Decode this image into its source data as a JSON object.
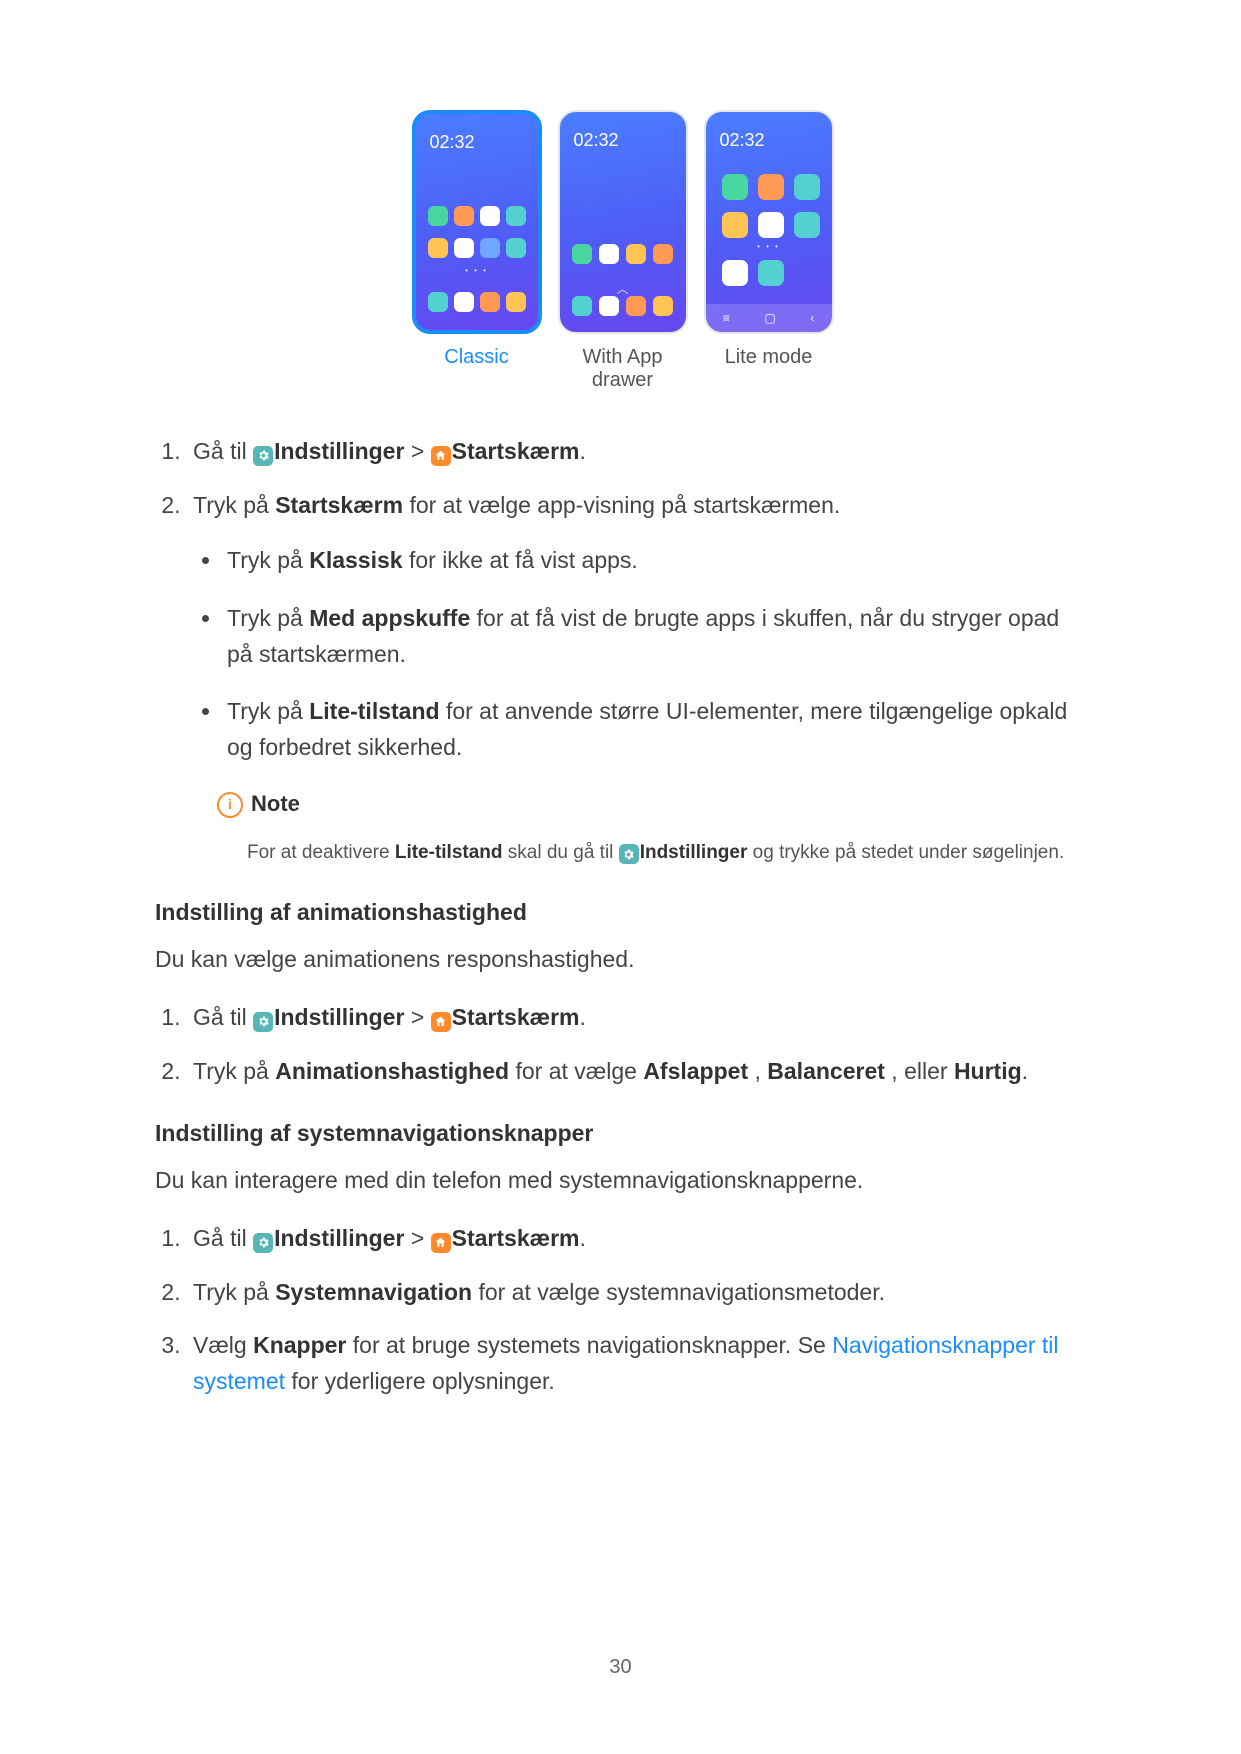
{
  "phones": {
    "clock": "02:32",
    "captions": {
      "classic": "Classic",
      "drawer": "With App drawer",
      "lite": "Lite mode"
    }
  },
  "section1": {
    "step1": {
      "prefix": "Gå til ",
      "settings": "Indstillinger",
      "sep": " > ",
      "home": "Startskærm",
      "end": "."
    },
    "step2": {
      "t1": "Tryk på ",
      "b1": "Startskærm",
      "t2": " for at vælge app-visning på startskærmen."
    },
    "bul1": {
      "t1": "Tryk på ",
      "b1": "Klassisk",
      "t2": " for ikke at få vist apps."
    },
    "bul2": {
      "t1": "Tryk på ",
      "b1": "Med appskuffe",
      "t2": " for at få vist de brugte apps i skuffen, når du stryger opad på startskærmen."
    },
    "bul3": {
      "t1": "Tryk på ",
      "b1": "Lite-tilstand",
      "t2": " for at anvende større UI-elementer, mere tilgængelige opkald og forbedret sikkerhed."
    }
  },
  "note": {
    "label": "Note",
    "t1": "For at deaktivere ",
    "b1": "Lite-tilstand",
    "t2": " skal du gå til ",
    "b2": "Indstillinger",
    "t3": " og trykke på stedet under søgelinjen."
  },
  "section2": {
    "heading": "Indstilling af animationshastighed",
    "intro": "Du kan vælge animationens responshastighed.",
    "step2": {
      "t1": "Tryk på ",
      "b1": "Animationshastighed",
      "t2": " for at vælge ",
      "b2": "Afslappet",
      "t3": " , ",
      "b3": "Balanceret",
      "t4": " , eller ",
      "b4": "Hurtig",
      "t5": "."
    }
  },
  "section3": {
    "heading": "Indstilling af systemnavigationsknapper",
    "intro": "Du kan interagere med din telefon med systemnavigationsknapperne.",
    "step2": {
      "t1": "Tryk på ",
      "b1": "Systemnavigation",
      "t2": " for at vælge systemnavigationsmetoder."
    },
    "step3": {
      "t1": "Vælg ",
      "b1": "Knapper",
      "t2": " for at bruge systemets navigationsknapper. Se ",
      "link": "Navigationsknapper til systemet",
      "t3": " for yderligere oplysninger."
    }
  },
  "page_number": "30"
}
